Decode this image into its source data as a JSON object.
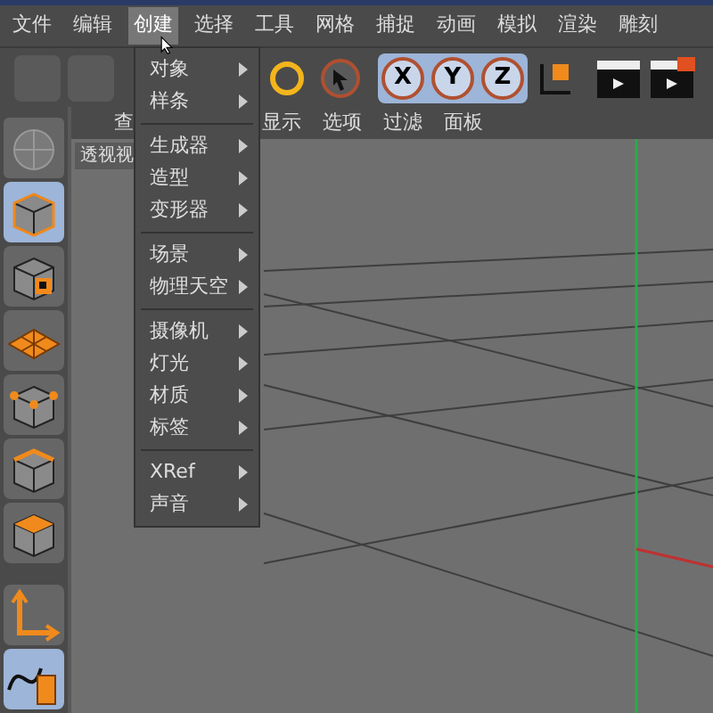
{
  "menubar": [
    {
      "label": "文件",
      "selected": false
    },
    {
      "label": "编辑",
      "selected": false
    },
    {
      "label": "创建",
      "selected": true
    },
    {
      "label": "选择",
      "selected": false
    },
    {
      "label": "工具",
      "selected": false
    },
    {
      "label": "网格",
      "selected": false
    },
    {
      "label": "捕捉",
      "selected": false
    },
    {
      "label": "动画",
      "selected": false
    },
    {
      "label": "模拟",
      "selected": false
    },
    {
      "label": "渲染",
      "selected": false
    },
    {
      "label": "雕刻",
      "selected": false
    }
  ],
  "toolbar": {
    "axis_buttons": [
      {
        "label": "X",
        "selected": true
      },
      {
        "label": "Y",
        "selected": true
      },
      {
        "label": "Z",
        "selected": true
      }
    ]
  },
  "palette": [
    {
      "kind": "cube",
      "selected": true
    },
    {
      "kind": "checker",
      "selected": false
    },
    {
      "kind": "plane",
      "selected": false
    },
    {
      "kind": "points",
      "selected": false
    },
    {
      "kind": "edges",
      "selected": false
    },
    {
      "kind": "polygons",
      "selected": false
    },
    {
      "kind": "axis",
      "selected": false
    },
    {
      "kind": "spline",
      "selected": true
    }
  ],
  "viewport": {
    "menu": [
      "查",
      "显示",
      "选项",
      "过滤",
      "面板"
    ],
    "label": "透视视"
  },
  "dropdown": [
    {
      "kind": "item",
      "label": "对象"
    },
    {
      "kind": "item",
      "label": "样条"
    },
    {
      "kind": "separator"
    },
    {
      "kind": "item",
      "label": "生成器"
    },
    {
      "kind": "item",
      "label": "造型"
    },
    {
      "kind": "item",
      "label": "变形器"
    },
    {
      "kind": "separator"
    },
    {
      "kind": "item",
      "label": "场景"
    },
    {
      "kind": "item",
      "label": "物理天空"
    },
    {
      "kind": "separator"
    },
    {
      "kind": "item",
      "label": "摄像机"
    },
    {
      "kind": "item",
      "label": "灯光"
    },
    {
      "kind": "item",
      "label": "材质"
    },
    {
      "kind": "item",
      "label": "标签"
    },
    {
      "kind": "separator"
    },
    {
      "kind": "item",
      "label": "XRef"
    },
    {
      "kind": "item",
      "label": "声音"
    }
  ]
}
